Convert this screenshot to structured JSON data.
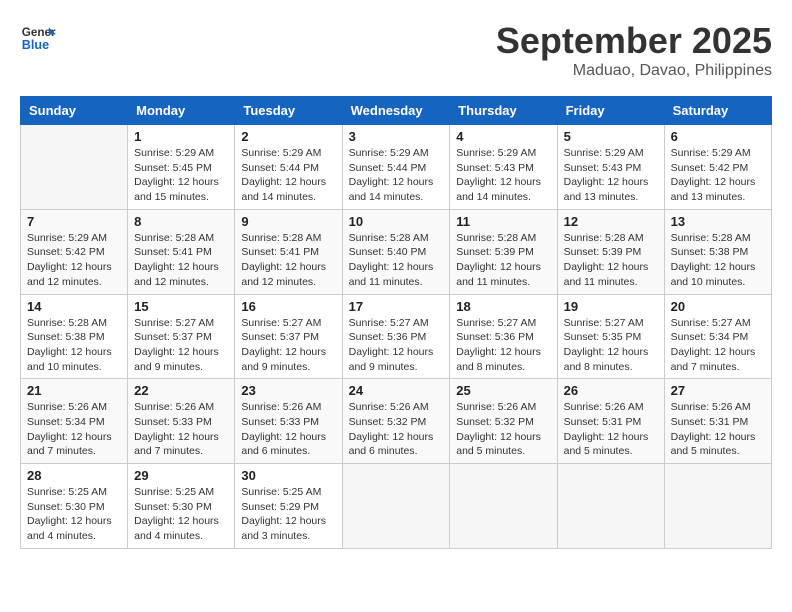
{
  "header": {
    "logo_line1": "General",
    "logo_line2": "Blue",
    "month": "September 2025",
    "location": "Maduao, Davao, Philippines"
  },
  "weekdays": [
    "Sunday",
    "Monday",
    "Tuesday",
    "Wednesday",
    "Thursday",
    "Friday",
    "Saturday"
  ],
  "weeks": [
    [
      {
        "day": "",
        "info": ""
      },
      {
        "day": "1",
        "info": "Sunrise: 5:29 AM\nSunset: 5:45 PM\nDaylight: 12 hours\nand 15 minutes."
      },
      {
        "day": "2",
        "info": "Sunrise: 5:29 AM\nSunset: 5:44 PM\nDaylight: 12 hours\nand 14 minutes."
      },
      {
        "day": "3",
        "info": "Sunrise: 5:29 AM\nSunset: 5:44 PM\nDaylight: 12 hours\nand 14 minutes."
      },
      {
        "day": "4",
        "info": "Sunrise: 5:29 AM\nSunset: 5:43 PM\nDaylight: 12 hours\nand 14 minutes."
      },
      {
        "day": "5",
        "info": "Sunrise: 5:29 AM\nSunset: 5:43 PM\nDaylight: 12 hours\nand 13 minutes."
      },
      {
        "day": "6",
        "info": "Sunrise: 5:29 AM\nSunset: 5:42 PM\nDaylight: 12 hours\nand 13 minutes."
      }
    ],
    [
      {
        "day": "7",
        "info": "Sunrise: 5:29 AM\nSunset: 5:42 PM\nDaylight: 12 hours\nand 12 minutes."
      },
      {
        "day": "8",
        "info": "Sunrise: 5:28 AM\nSunset: 5:41 PM\nDaylight: 12 hours\nand 12 minutes."
      },
      {
        "day": "9",
        "info": "Sunrise: 5:28 AM\nSunset: 5:41 PM\nDaylight: 12 hours\nand 12 minutes."
      },
      {
        "day": "10",
        "info": "Sunrise: 5:28 AM\nSunset: 5:40 PM\nDaylight: 12 hours\nand 11 minutes."
      },
      {
        "day": "11",
        "info": "Sunrise: 5:28 AM\nSunset: 5:39 PM\nDaylight: 12 hours\nand 11 minutes."
      },
      {
        "day": "12",
        "info": "Sunrise: 5:28 AM\nSunset: 5:39 PM\nDaylight: 12 hours\nand 11 minutes."
      },
      {
        "day": "13",
        "info": "Sunrise: 5:28 AM\nSunset: 5:38 PM\nDaylight: 12 hours\nand 10 minutes."
      }
    ],
    [
      {
        "day": "14",
        "info": "Sunrise: 5:28 AM\nSunset: 5:38 PM\nDaylight: 12 hours\nand 10 minutes."
      },
      {
        "day": "15",
        "info": "Sunrise: 5:27 AM\nSunset: 5:37 PM\nDaylight: 12 hours\nand 9 minutes."
      },
      {
        "day": "16",
        "info": "Sunrise: 5:27 AM\nSunset: 5:37 PM\nDaylight: 12 hours\nand 9 minutes."
      },
      {
        "day": "17",
        "info": "Sunrise: 5:27 AM\nSunset: 5:36 PM\nDaylight: 12 hours\nand 9 minutes."
      },
      {
        "day": "18",
        "info": "Sunrise: 5:27 AM\nSunset: 5:36 PM\nDaylight: 12 hours\nand 8 minutes."
      },
      {
        "day": "19",
        "info": "Sunrise: 5:27 AM\nSunset: 5:35 PM\nDaylight: 12 hours\nand 8 minutes."
      },
      {
        "day": "20",
        "info": "Sunrise: 5:27 AM\nSunset: 5:34 PM\nDaylight: 12 hours\nand 7 minutes."
      }
    ],
    [
      {
        "day": "21",
        "info": "Sunrise: 5:26 AM\nSunset: 5:34 PM\nDaylight: 12 hours\nand 7 minutes."
      },
      {
        "day": "22",
        "info": "Sunrise: 5:26 AM\nSunset: 5:33 PM\nDaylight: 12 hours\nand 7 minutes."
      },
      {
        "day": "23",
        "info": "Sunrise: 5:26 AM\nSunset: 5:33 PM\nDaylight: 12 hours\nand 6 minutes."
      },
      {
        "day": "24",
        "info": "Sunrise: 5:26 AM\nSunset: 5:32 PM\nDaylight: 12 hours\nand 6 minutes."
      },
      {
        "day": "25",
        "info": "Sunrise: 5:26 AM\nSunset: 5:32 PM\nDaylight: 12 hours\nand 5 minutes."
      },
      {
        "day": "26",
        "info": "Sunrise: 5:26 AM\nSunset: 5:31 PM\nDaylight: 12 hours\nand 5 minutes."
      },
      {
        "day": "27",
        "info": "Sunrise: 5:26 AM\nSunset: 5:31 PM\nDaylight: 12 hours\nand 5 minutes."
      }
    ],
    [
      {
        "day": "28",
        "info": "Sunrise: 5:25 AM\nSunset: 5:30 PM\nDaylight: 12 hours\nand 4 minutes."
      },
      {
        "day": "29",
        "info": "Sunrise: 5:25 AM\nSunset: 5:30 PM\nDaylight: 12 hours\nand 4 minutes."
      },
      {
        "day": "30",
        "info": "Sunrise: 5:25 AM\nSunset: 5:29 PM\nDaylight: 12 hours\nand 3 minutes."
      },
      {
        "day": "",
        "info": ""
      },
      {
        "day": "",
        "info": ""
      },
      {
        "day": "",
        "info": ""
      },
      {
        "day": "",
        "info": ""
      }
    ]
  ]
}
